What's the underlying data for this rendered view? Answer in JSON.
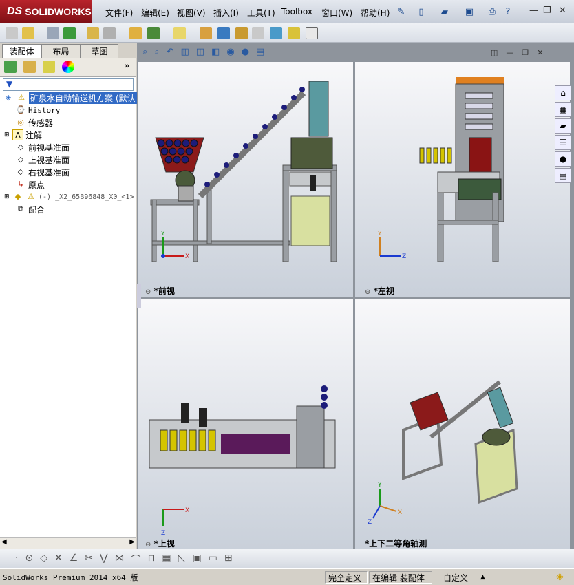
{
  "app": {
    "logo_prefix": "DS",
    "logo_text": "SOLIDWORKS"
  },
  "menu": [
    "文件(F)",
    "编辑(E)",
    "视图(V)",
    "插入(I)",
    "工具(T)",
    "Toolbox",
    "窗口(W)",
    "帮助(H)"
  ],
  "tabs": [
    "装配体",
    "布局",
    "草图"
  ],
  "tree": [
    {
      "label": "矿泉水自动输送机方案 (默认",
      "icon": "assembly-icon"
    },
    {
      "label": "History",
      "icon": "history-icon"
    },
    {
      "label": "传感器",
      "icon": "sensor-icon"
    },
    {
      "label": "注解",
      "icon": "annotation-icon"
    },
    {
      "label": "前视基准面",
      "icon": "plane-icon"
    },
    {
      "label": "上视基准面",
      "icon": "plane-icon"
    },
    {
      "label": "右视基准面",
      "icon": "plane-icon"
    },
    {
      "label": "原点",
      "icon": "origin-icon"
    },
    {
      "label": "(-) _X2_65B96848_X0_<1>",
      "icon": "part-icon"
    },
    {
      "label": "配合",
      "icon": "mate-icon"
    }
  ],
  "views": [
    {
      "label": "*前视"
    },
    {
      "label": "*左视"
    },
    {
      "label": "*上视"
    },
    {
      "label": "*上下二等角轴测"
    }
  ],
  "axes": {
    "x": "X",
    "y": "Y",
    "z": "Z"
  },
  "status": {
    "product": "SolidWorks Premium 2014 x64 版",
    "definition": "完全定义",
    "mode": "在编辑 装配体",
    "units": "自定义"
  },
  "colors": {
    "accent": "#b8232b",
    "frame": "#808488",
    "tank": "#d8e0a0",
    "bottle": "#1c1c7a",
    "cap": "#d4c400"
  }
}
